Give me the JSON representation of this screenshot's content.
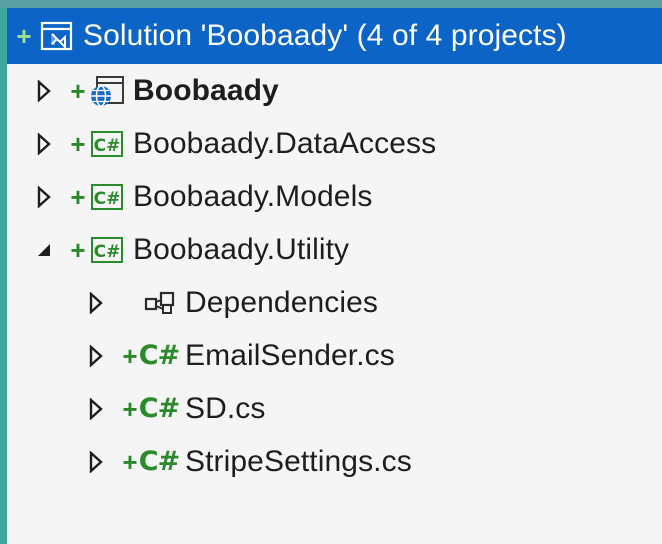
{
  "solution": {
    "label": "Solution 'Boobaady' (4 of 4 projects)",
    "plus": "+"
  },
  "projects": [
    {
      "label": "Boobaady",
      "plus": "+",
      "icon": "web-project-icon",
      "expanded": false,
      "bold": true
    },
    {
      "label": "Boobaady.DataAccess",
      "plus": "+",
      "icon": "csharp-project-icon",
      "expanded": false,
      "bold": false
    },
    {
      "label": "Boobaady.Models",
      "plus": "+",
      "icon": "csharp-project-icon",
      "expanded": false,
      "bold": false
    },
    {
      "label": "Boobaady.Utility",
      "plus": "+",
      "icon": "csharp-project-icon",
      "expanded": true,
      "bold": false
    }
  ],
  "utility_children": [
    {
      "label": "Dependencies",
      "plus": "",
      "icon": "dependencies-icon"
    },
    {
      "label": "EmailSender.cs",
      "plus": "+",
      "icon": "csharp-file-icon",
      "icon_text": "C#"
    },
    {
      "label": "SD.cs",
      "plus": "+",
      "icon": "csharp-file-icon",
      "icon_text": "C#"
    },
    {
      "label": "StripeSettings.cs",
      "plus": "+",
      "icon": "csharp-file-icon",
      "icon_text": "C#"
    }
  ],
  "colors": {
    "selection": "#0b64c6",
    "added_plus": "#2a8a2a",
    "csharp_green": "#2b8a2b",
    "panel_bg": "#f5f5f5",
    "desktop_bg": "#3fa79c"
  }
}
